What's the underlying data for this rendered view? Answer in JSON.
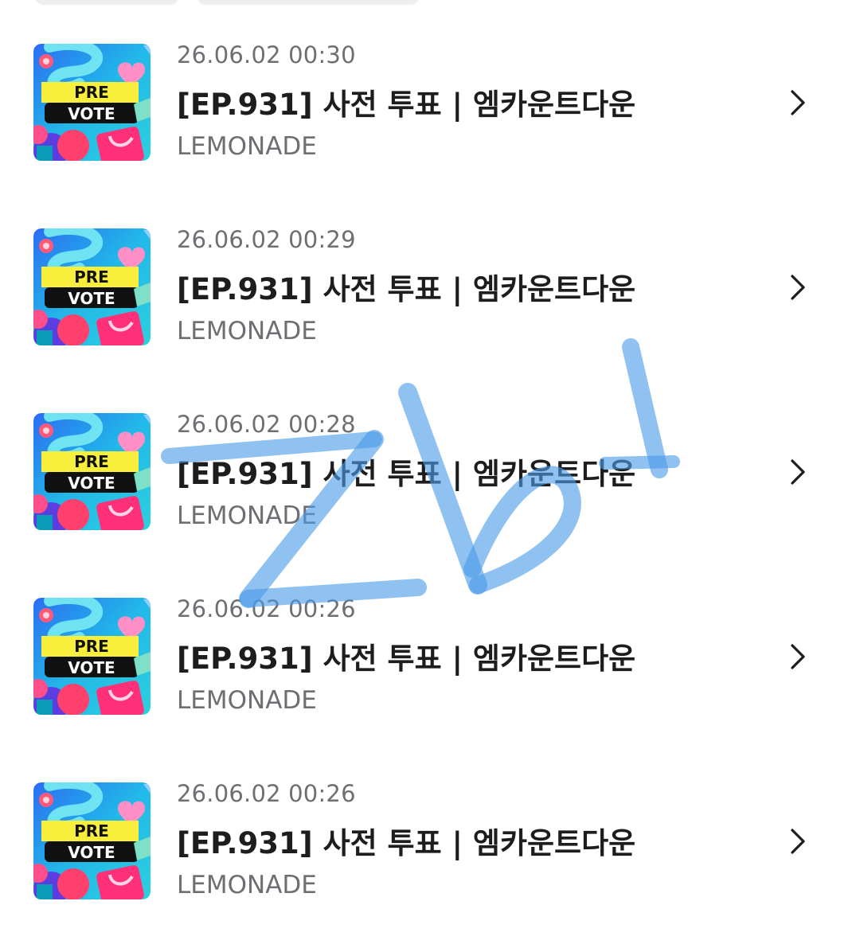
{
  "items": [
    {
      "date": "26.06.02 00:30",
      "title": "[EP.931] 사전 투표 | 엠카운트다운",
      "artist": "LEMONADE",
      "thumb_text_1": "PRE",
      "thumb_text_2": "VOTE"
    },
    {
      "date": "26.06.02 00:29",
      "title": "[EP.931] 사전 투표 | 엠카운트다운",
      "artist": "LEMONADE",
      "thumb_text_1": "PRE",
      "thumb_text_2": "VOTE"
    },
    {
      "date": "26.06.02 00:28",
      "title": "[EP.931] 사전 투표 | 엠카운트다운",
      "artist": "LEMONADE",
      "thumb_text_1": "PRE",
      "thumb_text_2": "VOTE"
    },
    {
      "date": "26.06.02 00:26",
      "title": "[EP.931] 사전 투표 | 엠카운트다운",
      "artist": "LEMONADE",
      "thumb_text_1": "PRE",
      "thumb_text_2": "VOTE"
    },
    {
      "date": "26.06.02 00:26",
      "title": "[EP.931] 사전 투표 | 엠카운트다운",
      "artist": "LEMONADE",
      "thumb_text_1": "PRE",
      "thumb_text_2": "VOTE"
    }
  ],
  "icons": {
    "chevron": "chevron-right-icon",
    "thumbnail": "pre-vote-thumbnail"
  },
  "colors": {
    "date_text": "#6e6e73",
    "title_text": "#1d1d1f",
    "scribble": "#4a9be8",
    "thumb_yellow": "#f7ef3c",
    "thumb_cyan": "#21c7e6",
    "thumb_blue": "#3a5cf0"
  },
  "annotation": {
    "handwritten_text": "ZbI"
  }
}
